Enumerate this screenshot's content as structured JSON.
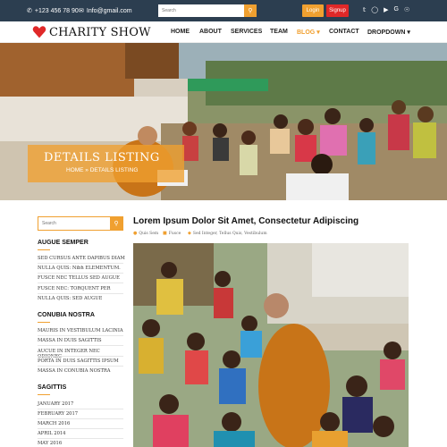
{
  "topbar": {
    "phone": "+123 456 78 90",
    "email": "Info@gmail.com",
    "search_placeholder": "Search",
    "login_label": "Login",
    "signup_label": "Signup",
    "socials": [
      "twitter-icon",
      "instagram-icon",
      "youtube-icon",
      "google-icon",
      "dribbble-icon"
    ]
  },
  "brand": {
    "name": "CHARITY SHOW",
    "heart_color": "#e02828"
  },
  "nav": {
    "home": "HOME",
    "about": "ABOUT",
    "services": "SERVICES",
    "team": "TEAM",
    "blog": "BLOG",
    "contact": "CONTACT",
    "dropdown": "DROPDOWN"
  },
  "hero": {
    "title": "DETAILS LISTING",
    "breadcrumb": "HOME » DETAILS LISTING"
  },
  "sidebar": {
    "search_placeholder": "Search",
    "section1": {
      "title": "AUGUE SEMPER",
      "items": [
        "SED CURSUS ANTE DAPIBUS DIAM",
        "NULLA QUIS: Nibh ELEMENTUM.",
        "FUSCE NEC TELLUS SED AUGUE",
        "FUSCE NEC: TORQUENT PER",
        "NULLA QUIS: SED AUGUE"
      ]
    },
    "section2": {
      "title": "CONUBIA NOSTRA",
      "items": [
        "MAURIS IN VESTIBULUM LACINIA",
        "MASSA IN DUIS SAGITTIS",
        "AUCUE IN INTEGER NEC ODIONEC",
        "PORTA IN DUIS SAGITTIS IPSUM",
        "MASSA IN CONUBIA NOSTRA"
      ]
    },
    "section3": {
      "title": "SAGITTIS",
      "items": [
        "JANUARY 2017",
        "FEBRUARY 2017",
        "MARCH 2016",
        "APRIL 2014",
        "MAY 2016"
      ]
    }
  },
  "post": {
    "title": "Lorem Ipsum Dolor Sit Amet, Consectetur Adipiscing",
    "meta": {
      "author": "Quis Sem",
      "category": "Fusce",
      "tags": "Sed Integer, Tellus Quis, Vestibulum"
    }
  },
  "colors": {
    "topbar": "#2c3e50",
    "accent": "#f0a030",
    "signup": "#e02828"
  }
}
